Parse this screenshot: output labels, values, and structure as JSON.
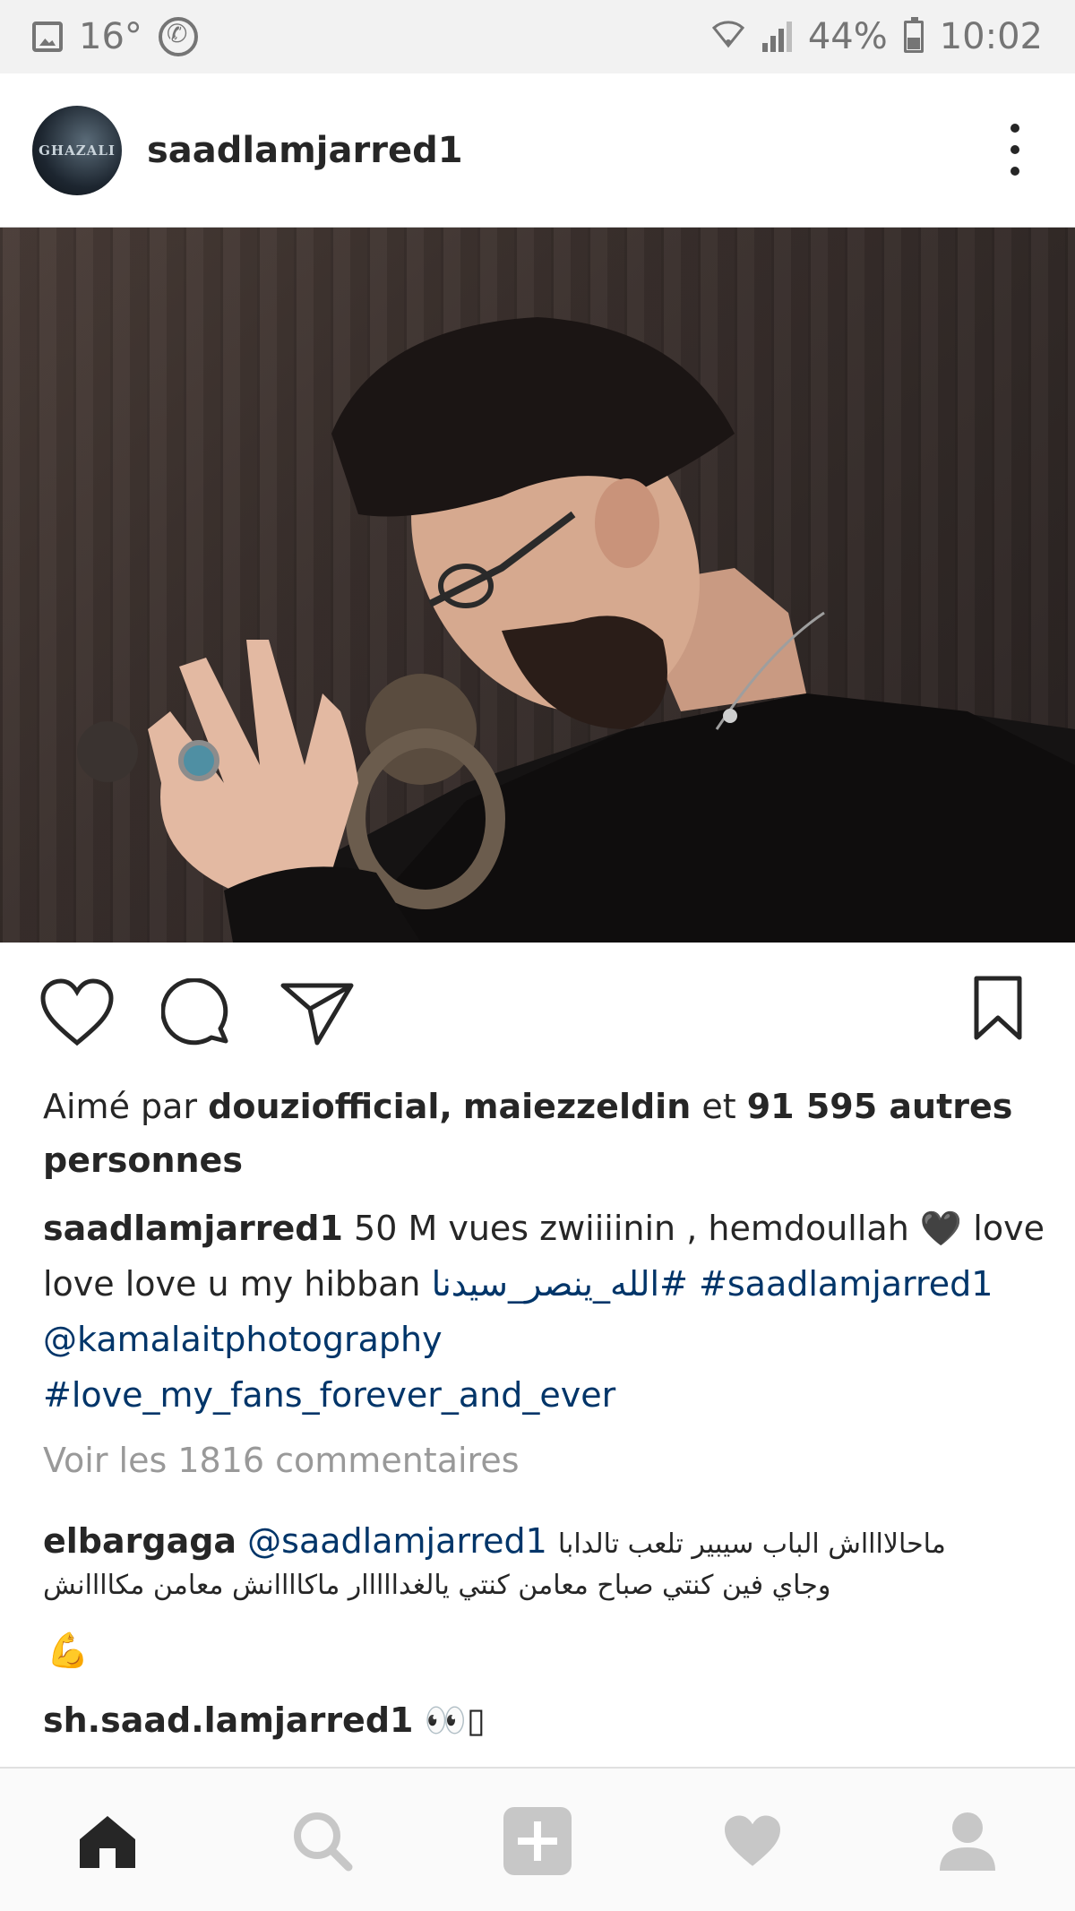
{
  "status_bar": {
    "temperature": "16°",
    "battery": "44%",
    "time": "10:02"
  },
  "post": {
    "username": "saadlamjarred1",
    "avatar_text": "GHAZALI",
    "likes": {
      "prefix": "Aimé par",
      "user1": "douziofficial,",
      "user2": "maiezzeldin",
      "and": "et",
      "count_text": "91 595 autres personnes"
    },
    "caption": {
      "author": "saadlamjarred1",
      "text1": "50 M  vues zwiiiinin , hemdoullah 🖤 love love love u my hibban",
      "hashtag_ar": "#الله_ينصر_سيدنا",
      "hashtag1": "#saadlamjarred1",
      "mention": "@kamalaitphotography",
      "hashtag2": "#love_my_fans_forever_and_ever"
    },
    "view_all_comments": "Voir les 1816 commentaires",
    "comments": [
      {
        "user": "elbargaga",
        "mention": "@saadlamjarred1",
        "text_line1": "ماحالااااش الباب سيبير تلعب تالدابا",
        "text_line2": "وجاي فين كنتي صباح معامن كنتي يالغدااااار ماكاااانش معامن مكاااانش",
        "emoji": "💪"
      },
      {
        "user": "sh.saad.lamjarred1",
        "text": "👀▯"
      }
    ]
  },
  "icons": {
    "like": "heart-icon",
    "comment": "comment-icon",
    "share": "send-icon",
    "save": "bookmark-icon",
    "more": "more-vertical-icon"
  },
  "bottom_nav": [
    "home-icon",
    "search-icon",
    "add-post-icon",
    "activity-heart-icon",
    "profile-icon"
  ],
  "colors": {
    "text": "#262626",
    "link": "#003569",
    "muted": "#999999",
    "nav_inactive": "#c7c7c7"
  }
}
